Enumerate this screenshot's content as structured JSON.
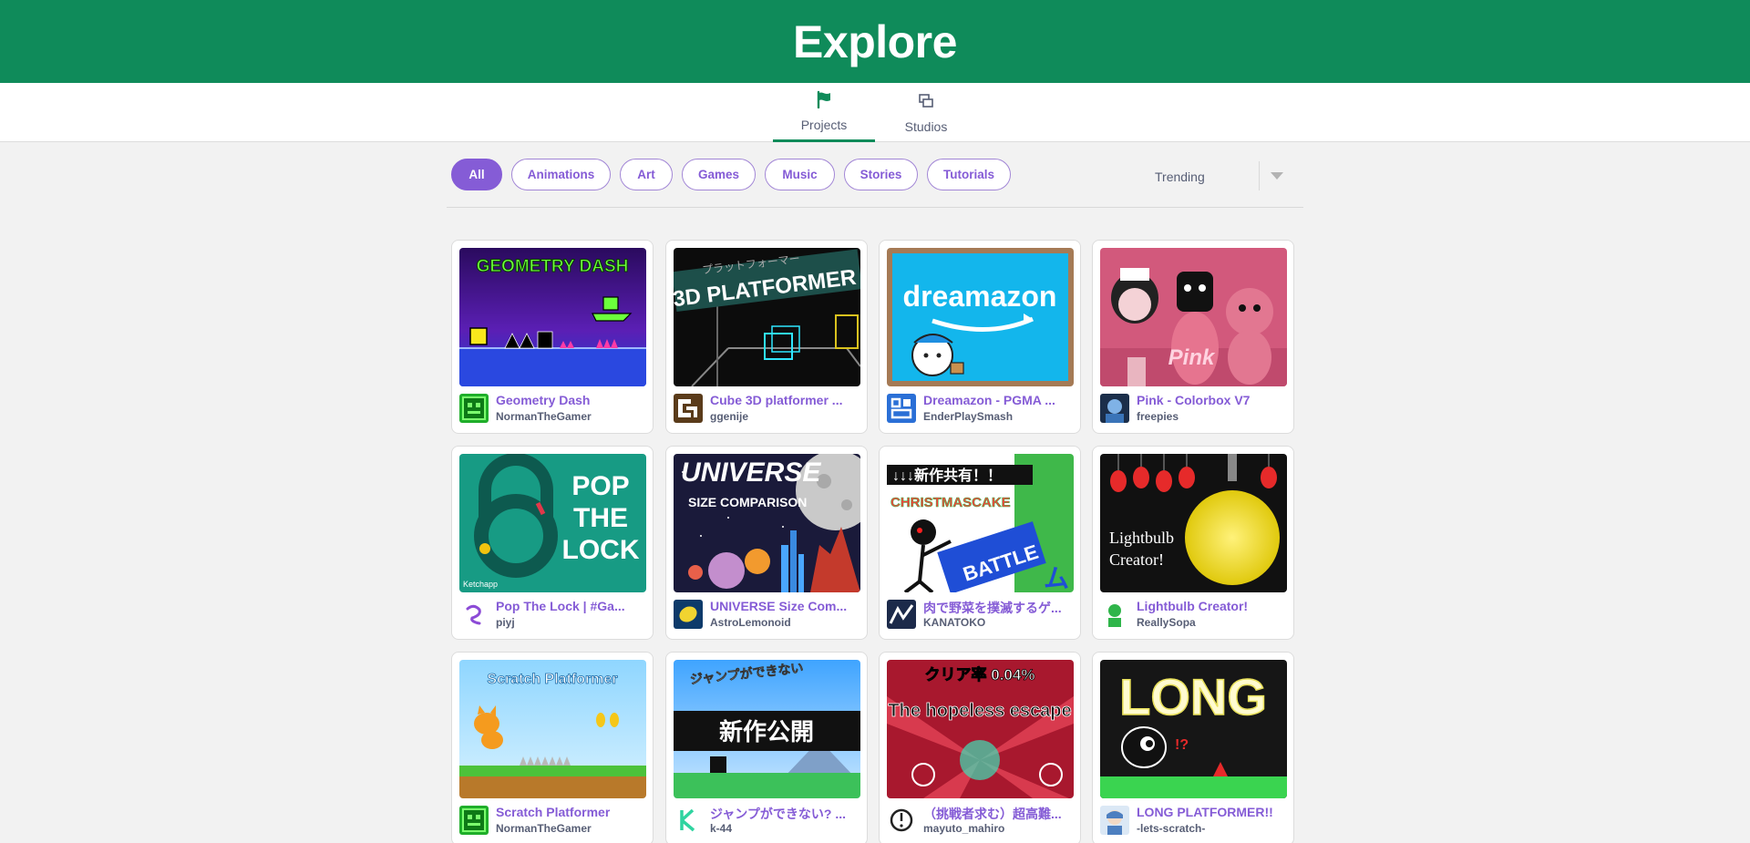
{
  "header": {
    "title": "Explore"
  },
  "tabs": [
    {
      "label": "Projects",
      "icon": "flag-icon",
      "active": true
    },
    {
      "label": "Studios",
      "icon": "studios-icon",
      "active": false
    }
  ],
  "filters": [
    {
      "label": "All",
      "active": true
    },
    {
      "label": "Animations"
    },
    {
      "label": "Art"
    },
    {
      "label": "Games"
    },
    {
      "label": "Music"
    },
    {
      "label": "Stories"
    },
    {
      "label": "Tutorials"
    }
  ],
  "sort": {
    "value": "Trending"
  },
  "colors": {
    "brand_green": "#0f8b5a",
    "accent_purple": "#855cd6",
    "text": "#575e75"
  },
  "projects": [
    {
      "title": "Geometry Dash",
      "author": "NormanTheGamer",
      "thumb_text": "GEOMETRY DASH"
    },
    {
      "title": "Cube 3D platformer ...",
      "author": "ggenije",
      "thumb_text": "3D PLATFORMER",
      "thumb_text2": "プラットフォーマー"
    },
    {
      "title": "Dreamazon - PGMA ...",
      "author": "EnderPlaySmash",
      "thumb_text": "dreamazon"
    },
    {
      "title": "Pink - Colorbox V7",
      "author": "freepies",
      "thumb_text": "Pink"
    },
    {
      "title": "Pop The Lock | #Ga...",
      "author": "piyj",
      "thumb_text": "POP",
      "thumb_text2": "THE",
      "thumb_text3": "LOCK",
      "thumb_text4": "Ketchapp"
    },
    {
      "title": "UNIVERSE Size Com...",
      "author": "AstroLemonoid",
      "thumb_text": "UNIVERSE",
      "thumb_text2": "SIZE COMPARISON"
    },
    {
      "title": "肉で野菜を撲滅するゲ...",
      "author": "KANATOKO",
      "thumb_text": "↓↓↓新作共有！！",
      "thumb_text2": "CHRISTMASCAKE",
      "thumb_text3": "BATTLE"
    },
    {
      "title": "Lightbulb Creator!",
      "author": "ReallySopa",
      "thumb_text": "Lightbulb",
      "thumb_text2": "Creator!"
    },
    {
      "title": "Scratch Platformer",
      "author": "NormanTheGamer",
      "thumb_text": "Scratch Platformer"
    },
    {
      "title": "ジャンプができない? ...",
      "author": "k-44",
      "thumb_text": "ジャンプができない",
      "thumb_text2": "新作公開"
    },
    {
      "title": "（挑戦者求む）超高難...",
      "author": "mayuto_mahiro",
      "thumb_text": "クリア率 0.04%",
      "thumb_text2": "The hopeless escape"
    },
    {
      "title": "LONG PLATFORMER!!",
      "author": "-lets-scratch-",
      "thumb_text": "LONG"
    }
  ]
}
